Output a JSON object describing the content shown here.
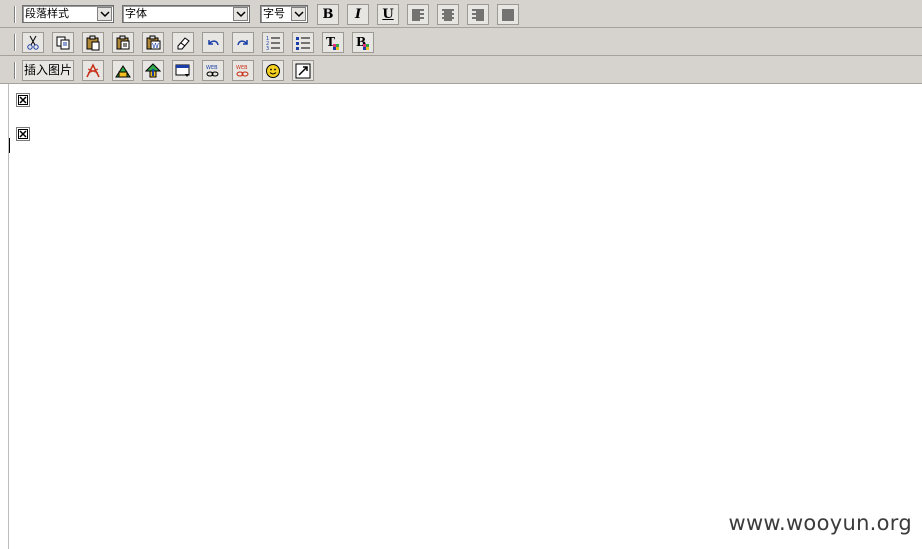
{
  "toolbar1": {
    "paragraph_style": "段落样式",
    "font": "字体",
    "font_size": "字号",
    "bold": "B",
    "italic": "I",
    "underline": "U"
  },
  "toolbar3": {
    "insert_image": "插入图片"
  },
  "icons": [
    "cut-icon",
    "copy-icon",
    "paste-icon",
    "paste-text-icon",
    "paste-word-icon",
    "eraser-icon",
    "undo-icon",
    "redo-icon",
    "ordered-list-icon",
    "unordered-list-icon",
    "text-color-icon",
    "background-color-icon",
    "flash-icon",
    "picture-icon",
    "upload-icon",
    "table-icon",
    "web-link-icon",
    "unlink-icon",
    "emoticon-icon",
    "fullscreen-icon"
  ],
  "watermark": "www.wooyun.org"
}
